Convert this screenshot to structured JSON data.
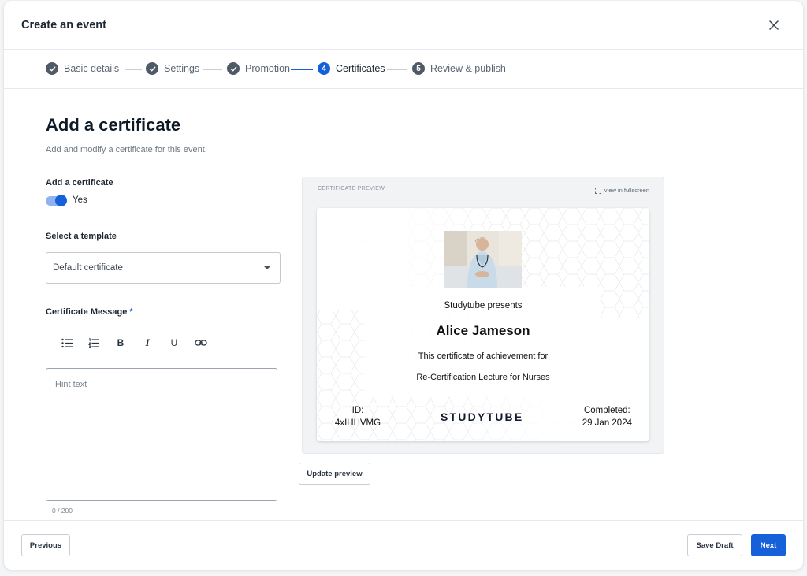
{
  "modal": {
    "title": "Create an event"
  },
  "steps": [
    {
      "label": "Basic details",
      "state": "done"
    },
    {
      "label": "Settings",
      "state": "done"
    },
    {
      "label": "Promotion",
      "state": "done"
    },
    {
      "label": "Certificates",
      "state": "active",
      "number": "4"
    },
    {
      "label": "Review & publish",
      "state": "todo",
      "number": "5"
    }
  ],
  "page": {
    "title": "Add a certificate",
    "subtitle": "Add and modify a certificate for this event."
  },
  "form": {
    "add_certificate_label": "Add a certificate",
    "toggle_value": "Yes",
    "toggle_on": true,
    "template_label": "Select a template",
    "template_value": "Default certificate",
    "message_label": "Certificate Message",
    "required_mark": "*",
    "message_placeholder": "Hint text",
    "char_count": "0 / 200",
    "toolbar": [
      "bullet-list",
      "numbered-list",
      "bold",
      "italic",
      "underline",
      "link"
    ],
    "toolbar_glyphs": {
      "bold": "B",
      "italic": "I",
      "underline": "U"
    }
  },
  "preview": {
    "label": "CERTIFICATE PREVIEW",
    "fullscreen_label": "view in fullscreen",
    "update_button": "Update preview",
    "certificate": {
      "presents": "Studytube presents",
      "name": "Alice Jameson",
      "description": "This certificate of achievement for",
      "course": "Re-Certification Lecture for Nurses",
      "id_label": "ID:",
      "id_value": "4xIHHVMG",
      "logo": "STUDYTUBE",
      "completed_label": "Completed:",
      "completed_date": "29 Jan 2024"
    }
  },
  "footer": {
    "previous": "Previous",
    "save_draft": "Save Draft",
    "next": "Next"
  },
  "colors": {
    "accent": "#1660d9",
    "step_done": "#4f5a66",
    "text": "#1d2733"
  }
}
